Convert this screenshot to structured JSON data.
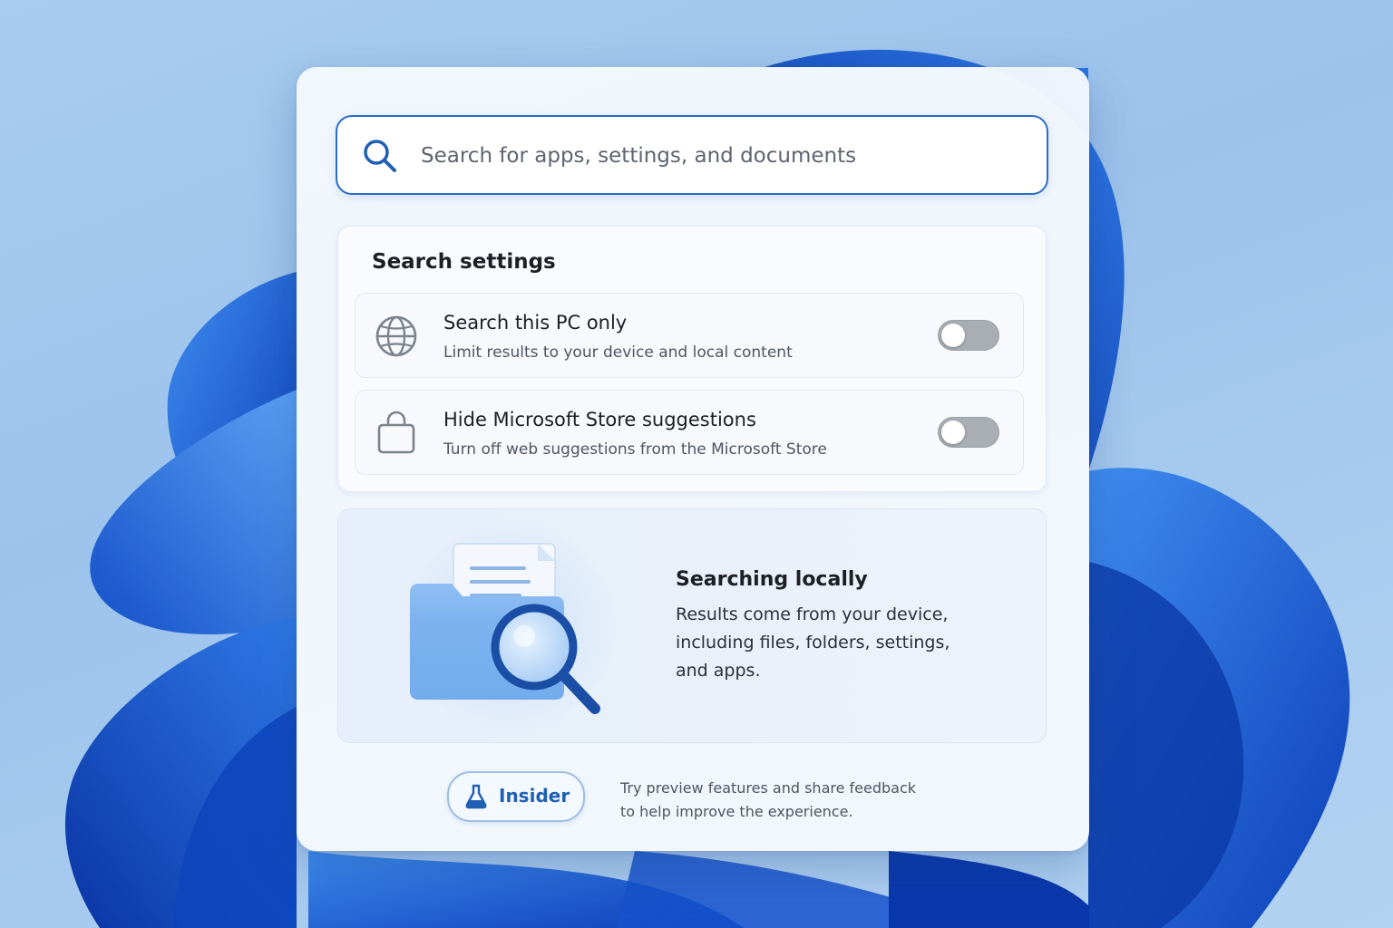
{
  "search": {
    "placeholder": "Search for apps, settings, and documents",
    "icon": "search-icon"
  },
  "settings": {
    "title": "Search settings",
    "items": [
      {
        "icon": "globe-icon",
        "title": "Search this PC only",
        "subtitle": "Limit results to your device and local content",
        "toggle_on": false
      },
      {
        "icon": "shopping-bag-icon",
        "title": "Hide Microsoft Store suggestions",
        "subtitle": "Turn off web suggestions from the Microsoft Store",
        "toggle_on": false
      }
    ]
  },
  "info": {
    "title": "Searching locally",
    "body": "Results come from your device, including files, folders, settings, and apps.",
    "illustration": "folder-search-illustration"
  },
  "footer": {
    "insider_label": "Insider",
    "insider_icon": "flask-icon",
    "note_lines": [
      "Try preview features and share feedback",
      "to help improve the experience."
    ]
  },
  "colors": {
    "accent": "#2b6cc4",
    "toggle_off": "#a9aeb5",
    "wallpaper_bloom": "#1a5fd8"
  }
}
